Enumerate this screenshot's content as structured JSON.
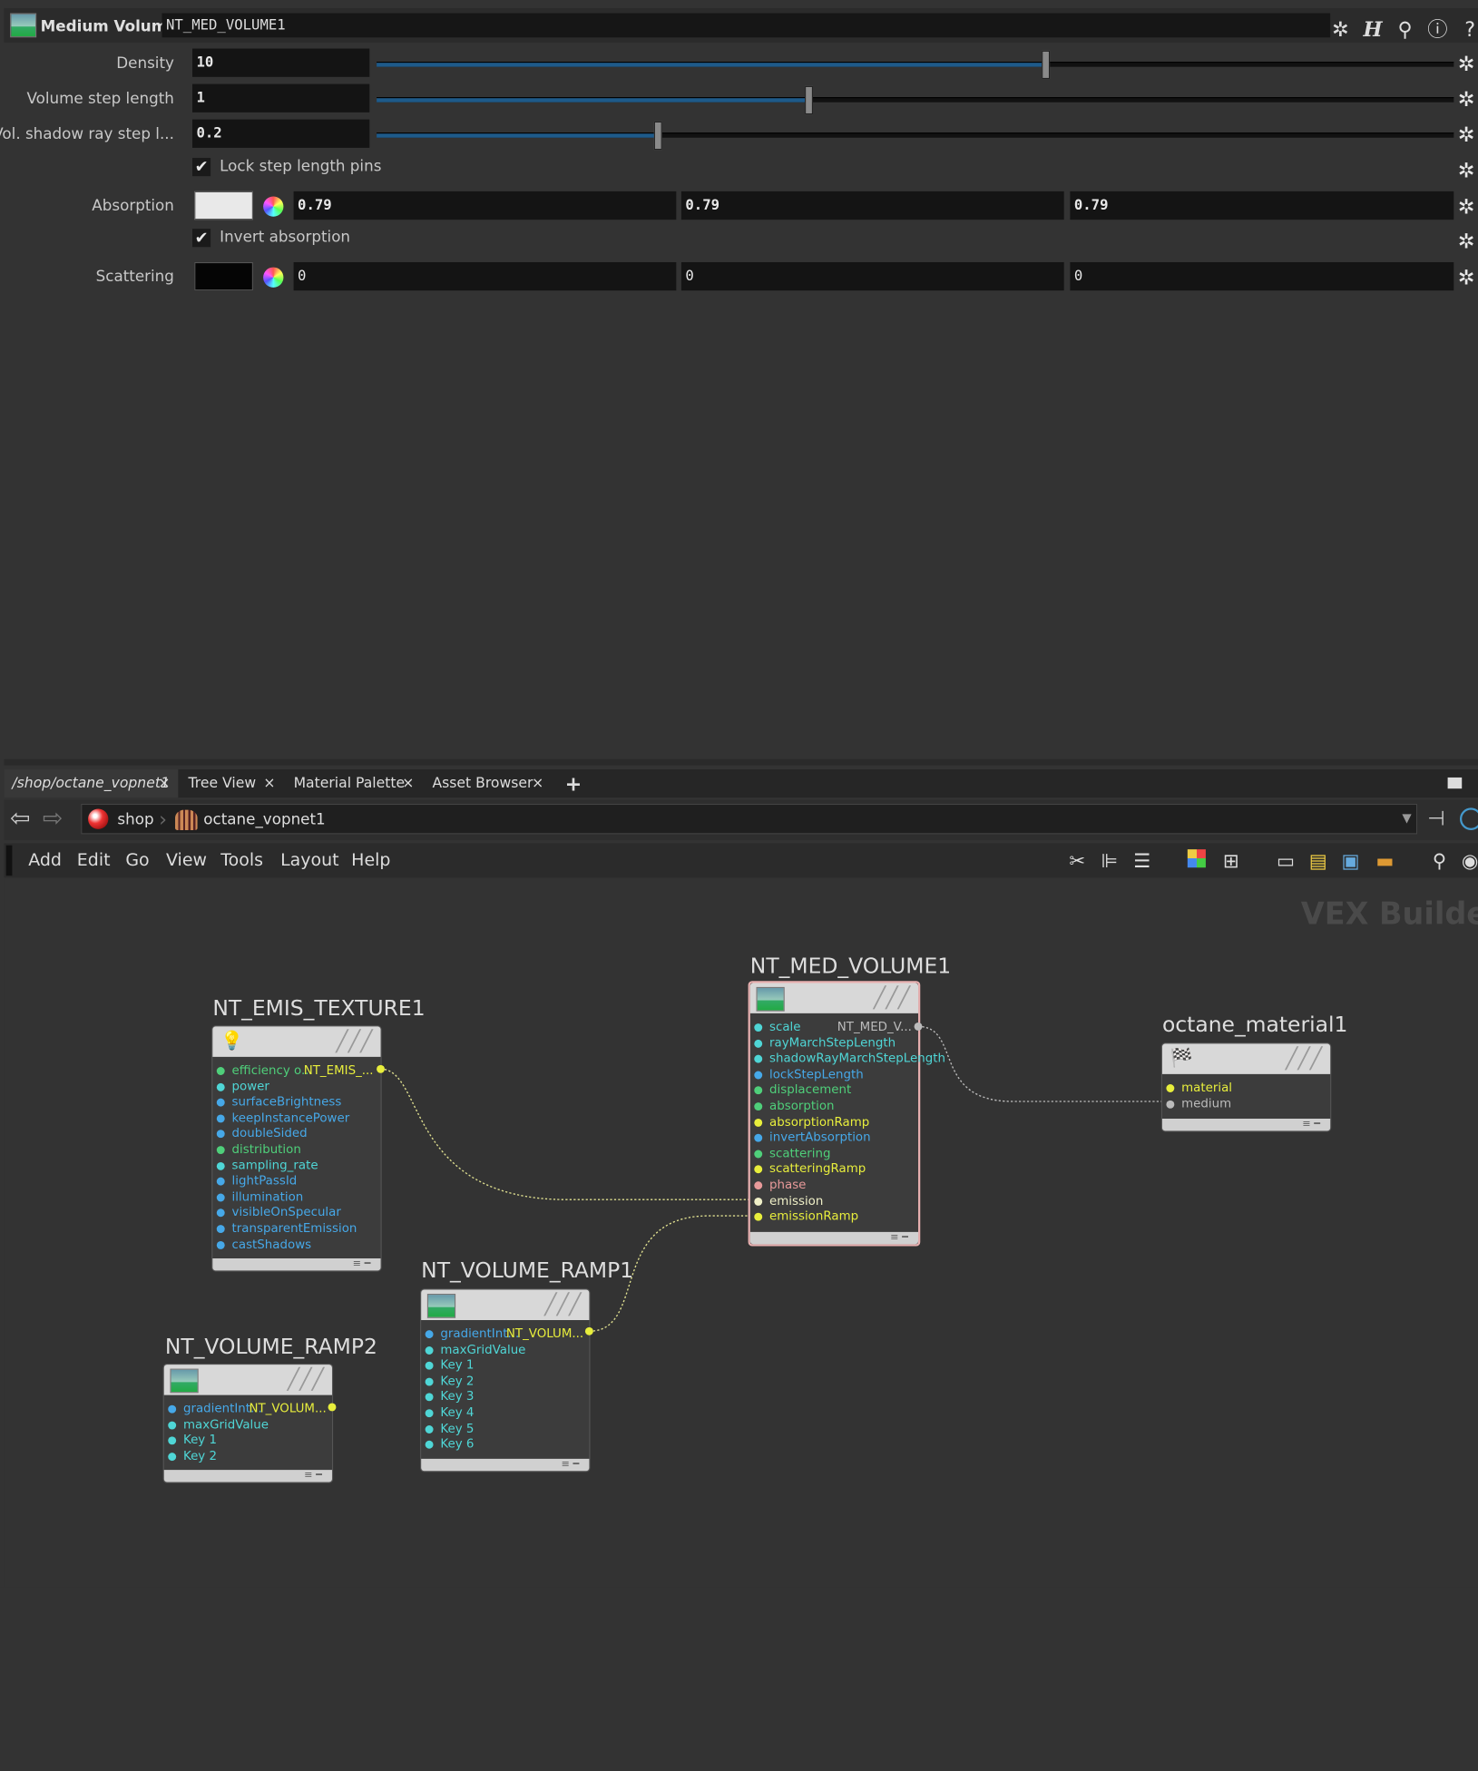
{
  "header": {
    "node_type": "Medium Volume",
    "node_name": "NT_MED_VOLUME1"
  },
  "params": {
    "density": {
      "label": "Density",
      "value": "10",
      "slider_fraction": 0.62
    },
    "step": {
      "label": "Volume step length",
      "value": "1",
      "slider_fraction": 0.4
    },
    "shadow_step": {
      "label": "Vol. shadow ray step l...",
      "value": "0.2",
      "slider_fraction": 0.26
    },
    "lock_pins": {
      "label": "Lock step length pins",
      "checked": true
    },
    "absorption": {
      "label": "Absorption",
      "r": "0.79",
      "g": "0.79",
      "b": "0.79",
      "swatch": "#e9e9e9"
    },
    "invert_absorption": {
      "label": "Invert absorption",
      "checked": true
    },
    "scattering": {
      "label": "Scattering",
      "r": "0",
      "g": "0",
      "b": "0",
      "swatch": "#050505"
    }
  },
  "tabs": [
    {
      "label": "/shop/octane_vopnet1",
      "close": "×"
    },
    {
      "label": "Tree View",
      "close": "×"
    },
    {
      "label": "Material Palette",
      "close": "×"
    },
    {
      "label": "Asset Browser",
      "close": "×"
    },
    {
      "label": "+"
    }
  ],
  "path": {
    "root": "shop",
    "child": "octane_vopnet1"
  },
  "menu": [
    "Add",
    "Edit",
    "Go",
    "View",
    "Tools",
    "Layout",
    "Help"
  ],
  "network_label": "VEX Builder",
  "nodes": {
    "emis": {
      "name": "NT_EMIS_TEXTURE1",
      "output": "NT_EMIS_...",
      "ports": [
        {
          "label": "efficiency o...",
          "color": "#4fcf7a"
        },
        {
          "label": "power",
          "color": "#4fd6d6"
        },
        {
          "label": "surfaceBrightness",
          "color": "#46a8e8"
        },
        {
          "label": "keepInstancePower",
          "color": "#46a8e8"
        },
        {
          "label": "doubleSided",
          "color": "#46a8e8"
        },
        {
          "label": "distribution",
          "color": "#4fcf7a"
        },
        {
          "label": "sampling_rate",
          "color": "#4fd6d6"
        },
        {
          "label": "lightPassId",
          "color": "#46a8e8"
        },
        {
          "label": "illumination",
          "color": "#46a8e8"
        },
        {
          "label": "visibleOnSpecular",
          "color": "#46a8e8"
        },
        {
          "label": "transparentEmission",
          "color": "#46a8e8"
        },
        {
          "label": "castShadows",
          "color": "#46a8e8"
        }
      ]
    },
    "med": {
      "name": "NT_MED_VOLUME1",
      "output": "NT_MED_V...",
      "ports": [
        {
          "label": "scale",
          "color": "#4fd6d6"
        },
        {
          "label": "rayMarchStepLength",
          "color": "#4fd6d6"
        },
        {
          "label": "shadowRayMarchStepLength",
          "color": "#4fd6d6"
        },
        {
          "label": "lockStepLength",
          "color": "#46a8e8"
        },
        {
          "label": "displacement",
          "color": "#4fcf7a"
        },
        {
          "label": "absorption",
          "color": "#4fcf7a"
        },
        {
          "label": "absorptionRamp",
          "color": "#e8ee3c"
        },
        {
          "label": "invertAbsorption",
          "color": "#46a8e8"
        },
        {
          "label": "scattering",
          "color": "#4fcf7a"
        },
        {
          "label": "scatteringRamp",
          "color": "#e8ee3c"
        },
        {
          "label": "phase",
          "color": "#e89a9a"
        },
        {
          "label": "emission",
          "color": "#f0f0c8"
        },
        {
          "label": "emissionRamp",
          "color": "#e8ee3c"
        }
      ]
    },
    "mat": {
      "name": "octane_material1",
      "ports": [
        {
          "label": "material",
          "color": "#e8ee3c"
        },
        {
          "label": "medium",
          "color": "#bbbbbb"
        }
      ]
    },
    "ramp1": {
      "name": "NT_VOLUME_RAMP1",
      "output": "NT_VOLUM...",
      "ports": [
        {
          "label": "gradientInt...",
          "color": "#46a8e8"
        },
        {
          "label": "maxGridValue",
          "color": "#4fd6d6"
        },
        {
          "label": "Key 1",
          "color": "#4fd6d6"
        },
        {
          "label": "Key 2",
          "color": "#4fd6d6"
        },
        {
          "label": "Key 3",
          "color": "#4fd6d6"
        },
        {
          "label": "Key 4",
          "color": "#4fd6d6"
        },
        {
          "label": "Key 5",
          "color": "#4fd6d6"
        },
        {
          "label": "Key 6",
          "color": "#4fd6d6"
        }
      ]
    },
    "ramp2": {
      "name": "NT_VOLUME_RAMP2",
      "output": "NT_VOLUM...",
      "ports": [
        {
          "label": "gradientInt...",
          "color": "#46a8e8"
        },
        {
          "label": "maxGridValue",
          "color": "#4fd6d6"
        },
        {
          "label": "Key 1",
          "color": "#4fd6d6"
        },
        {
          "label": "Key 2",
          "color": "#4fd6d6"
        }
      ]
    }
  }
}
